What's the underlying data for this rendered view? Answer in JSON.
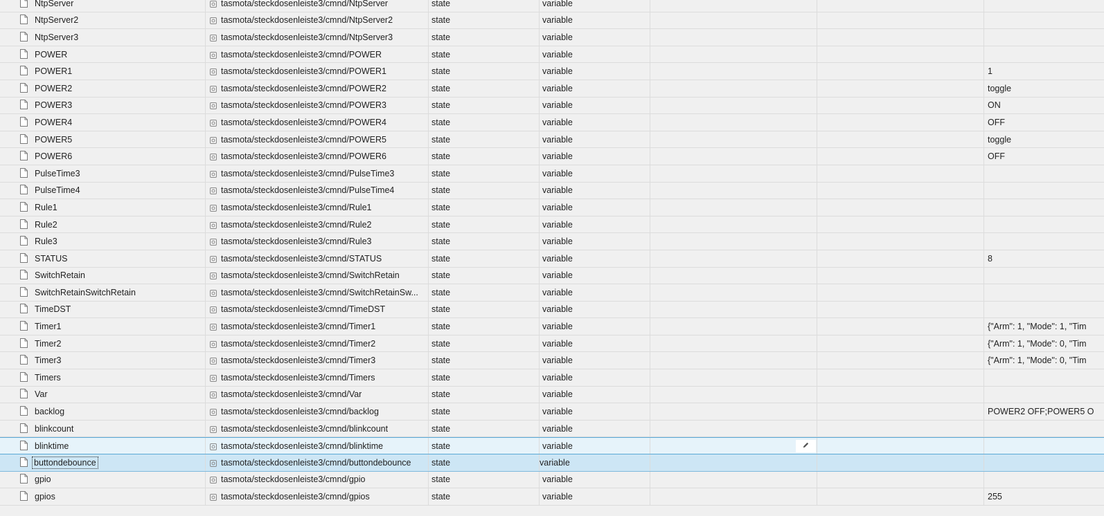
{
  "rows": [
    {
      "name": "NtpServer",
      "id": "tasmota/steckdosenleiste3/cmnd/NtpServer",
      "type": "state",
      "role": "variable",
      "value": ""
    },
    {
      "name": "NtpServer2",
      "id": "tasmota/steckdosenleiste3/cmnd/NtpServer2",
      "type": "state",
      "role": "variable",
      "value": ""
    },
    {
      "name": "NtpServer3",
      "id": "tasmota/steckdosenleiste3/cmnd/NtpServer3",
      "type": "state",
      "role": "variable",
      "value": ""
    },
    {
      "name": "POWER",
      "id": "tasmota/steckdosenleiste3/cmnd/POWER",
      "type": "state",
      "role": "variable",
      "value": ""
    },
    {
      "name": "POWER1",
      "id": "tasmota/steckdosenleiste3/cmnd/POWER1",
      "type": "state",
      "role": "variable",
      "value": "1"
    },
    {
      "name": "POWER2",
      "id": "tasmota/steckdosenleiste3/cmnd/POWER2",
      "type": "state",
      "role": "variable",
      "value": "toggle"
    },
    {
      "name": "POWER3",
      "id": "tasmota/steckdosenleiste3/cmnd/POWER3",
      "type": "state",
      "role": "variable",
      "value": "ON"
    },
    {
      "name": "POWER4",
      "id": "tasmota/steckdosenleiste3/cmnd/POWER4",
      "type": "state",
      "role": "variable",
      "value": "OFF"
    },
    {
      "name": "POWER5",
      "id": "tasmota/steckdosenleiste3/cmnd/POWER5",
      "type": "state",
      "role": "variable",
      "value": "toggle"
    },
    {
      "name": "POWER6",
      "id": "tasmota/steckdosenleiste3/cmnd/POWER6",
      "type": "state",
      "role": "variable",
      "value": "OFF"
    },
    {
      "name": "PulseTime3",
      "id": "tasmota/steckdosenleiste3/cmnd/PulseTime3",
      "type": "state",
      "role": "variable",
      "value": ""
    },
    {
      "name": "PulseTime4",
      "id": "tasmota/steckdosenleiste3/cmnd/PulseTime4",
      "type": "state",
      "role": "variable",
      "value": ""
    },
    {
      "name": "Rule1",
      "id": "tasmota/steckdosenleiste3/cmnd/Rule1",
      "type": "state",
      "role": "variable",
      "value": ""
    },
    {
      "name": "Rule2",
      "id": "tasmota/steckdosenleiste3/cmnd/Rule2",
      "type": "state",
      "role": "variable",
      "value": ""
    },
    {
      "name": "Rule3",
      "id": "tasmota/steckdosenleiste3/cmnd/Rule3",
      "type": "state",
      "role": "variable",
      "value": ""
    },
    {
      "name": "STATUS",
      "id": "tasmota/steckdosenleiste3/cmnd/STATUS",
      "type": "state",
      "role": "variable",
      "value": "8"
    },
    {
      "name": "SwitchRetain",
      "id": "tasmota/steckdosenleiste3/cmnd/SwitchRetain",
      "type": "state",
      "role": "variable",
      "value": ""
    },
    {
      "name": "SwitchRetainSwitchRetain",
      "id": "tasmota/steckdosenleiste3/cmnd/SwitchRetainSw...",
      "type": "state",
      "role": "variable",
      "value": ""
    },
    {
      "name": "TimeDST",
      "id": "tasmota/steckdosenleiste3/cmnd/TimeDST",
      "type": "state",
      "role": "variable",
      "value": ""
    },
    {
      "name": "Timer1",
      "id": "tasmota/steckdosenleiste3/cmnd/Timer1",
      "type": "state",
      "role": "variable",
      "value": "{\"Arm\": 1, \"Mode\": 1, \"Tim"
    },
    {
      "name": "Timer2",
      "id": "tasmota/steckdosenleiste3/cmnd/Timer2",
      "type": "state",
      "role": "variable",
      "value": "{\"Arm\": 1, \"Mode\": 0, \"Tim"
    },
    {
      "name": "Timer3",
      "id": "tasmota/steckdosenleiste3/cmnd/Timer3",
      "type": "state",
      "role": "variable",
      "value": "{\"Arm\": 1, \"Mode\": 0, \"Tim"
    },
    {
      "name": "Timers",
      "id": "tasmota/steckdosenleiste3/cmnd/Timers",
      "type": "state",
      "role": "variable",
      "value": ""
    },
    {
      "name": "Var",
      "id": "tasmota/steckdosenleiste3/cmnd/Var",
      "type": "state",
      "role": "variable",
      "value": ""
    },
    {
      "name": "backlog",
      "id": "tasmota/steckdosenleiste3/cmnd/backlog",
      "type": "state",
      "role": "variable",
      "value": "POWER2 OFF;POWER5 O"
    },
    {
      "name": "blinkcount",
      "id": "tasmota/steckdosenleiste3/cmnd/blinkcount",
      "type": "state",
      "role": "variable",
      "value": ""
    },
    {
      "name": "blinktime",
      "id": "tasmota/steckdosenleiste3/cmnd/blinktime",
      "type": "state",
      "role": "variable",
      "value": "",
      "state": "hover"
    },
    {
      "name": "buttondebounce",
      "id": "tasmota/steckdosenleiste3/cmnd/buttondebounce",
      "type": "state",
      "role": "variable",
      "value": "",
      "state": "selected"
    },
    {
      "name": "gpio",
      "id": "tasmota/steckdosenleiste3/cmnd/gpio",
      "type": "state",
      "role": "variable",
      "value": ""
    },
    {
      "name": "gpios",
      "id": "tasmota/steckdosenleiste3/cmnd/gpios",
      "type": "state",
      "role": "variable",
      "value": "255"
    }
  ],
  "icons": {
    "row_icon": "file-icon",
    "id_icon": "state-icon",
    "edit_icon": "pencil-icon"
  },
  "colors": {
    "hover_row": "#e6f3fa",
    "selected_row": "#cde6f5",
    "accent_border": "#5aa9d6"
  }
}
